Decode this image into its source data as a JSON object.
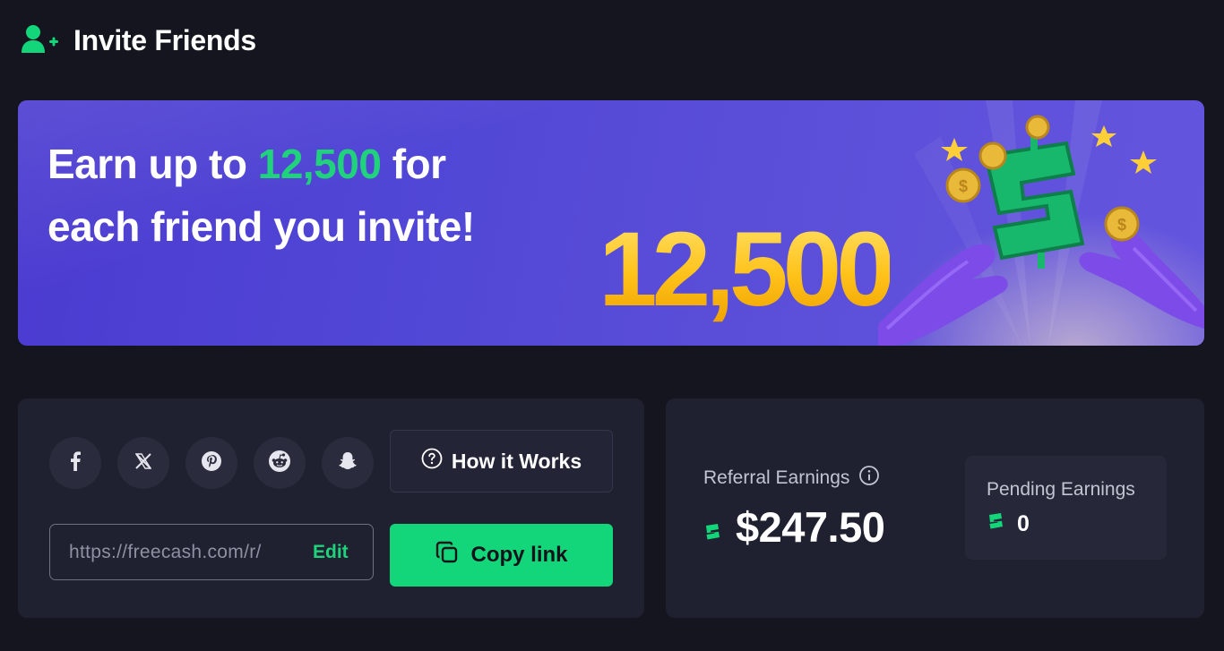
{
  "header": {
    "icon": "add-user-icon",
    "title": "Invite Friends"
  },
  "banner": {
    "headline_prefix": "Earn up to",
    "headline_amount": "12,500",
    "headline_suffix": "for each friend you invite!",
    "big_number": "12,500",
    "accent_color": "#20d27c",
    "number_color": "#ffc21a"
  },
  "share": {
    "social_buttons": [
      {
        "icon": "facebook-icon"
      },
      {
        "icon": "x-icon"
      },
      {
        "icon": "pinterest-icon"
      },
      {
        "icon": "reddit-icon"
      },
      {
        "icon": "snapchat-icon"
      }
    ],
    "how_it_works_label": "How it Works",
    "link_value": "https://freecash.com/r/",
    "edit_label": "Edit",
    "copy_label": "Copy link"
  },
  "earnings": {
    "referral_label": "Referral Earnings",
    "referral_value": "$247.50",
    "pending_label": "Pending Earnings",
    "pending_value": "0"
  },
  "colors": {
    "background": "#14151f",
    "card": "#1f2030",
    "brand_green": "#13d67a"
  }
}
